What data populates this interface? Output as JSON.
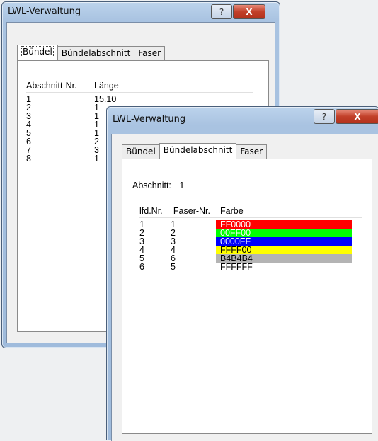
{
  "back_window": {
    "title": "LWL-Verwaltung",
    "help_label": "?",
    "close_label": "X",
    "tabs": [
      "Bündel",
      "Bündelabschnitt",
      "Faser"
    ],
    "columns": [
      "Abschnitt-Nr.",
      "Länge"
    ],
    "rows": [
      {
        "nr": "1",
        "laenge": "15.10"
      },
      {
        "nr": "2",
        "laenge": "1"
      },
      {
        "nr": "3",
        "laenge": "1"
      },
      {
        "nr": "4",
        "laenge": "1"
      },
      {
        "nr": "5",
        "laenge": "1"
      },
      {
        "nr": "6",
        "laenge": "2"
      },
      {
        "nr": "7",
        "laenge": "3"
      },
      {
        "nr": "8",
        "laenge": "1"
      }
    ]
  },
  "front_window": {
    "title": "LWL-Verwaltung",
    "help_label": "?",
    "close_label": "X",
    "tabs": [
      "Bündel",
      "Bündelabschnitt",
      "Faser"
    ],
    "abschnitt_label": "Abschnitt:",
    "abschnitt_value": "1",
    "columns": [
      "lfd.Nr.",
      "Faser-Nr.",
      "Farbe"
    ],
    "rows": [
      {
        "lfd": "1",
        "faser": "1",
        "farbe": "FF0000",
        "bg": "#FF0000",
        "fg": "#ffffff"
      },
      {
        "lfd": "2",
        "faser": "2",
        "farbe": "00FF00",
        "bg": "#00FF00",
        "fg": "#ffffff"
      },
      {
        "lfd": "3",
        "faser": "3",
        "farbe": "0000FF",
        "bg": "#0000FF",
        "fg": "#ffffff"
      },
      {
        "lfd": "4",
        "faser": "4",
        "farbe": "FFFF00",
        "bg": "#FFFF00",
        "fg": "#000000"
      },
      {
        "lfd": "5",
        "faser": "6",
        "farbe": "B4B4B4",
        "bg": "#B4B4B4",
        "fg": "#000000"
      },
      {
        "lfd": "6",
        "faser": "5",
        "farbe": "FFFFFF",
        "bg": "#FFFFFF",
        "fg": "#000000"
      }
    ]
  }
}
